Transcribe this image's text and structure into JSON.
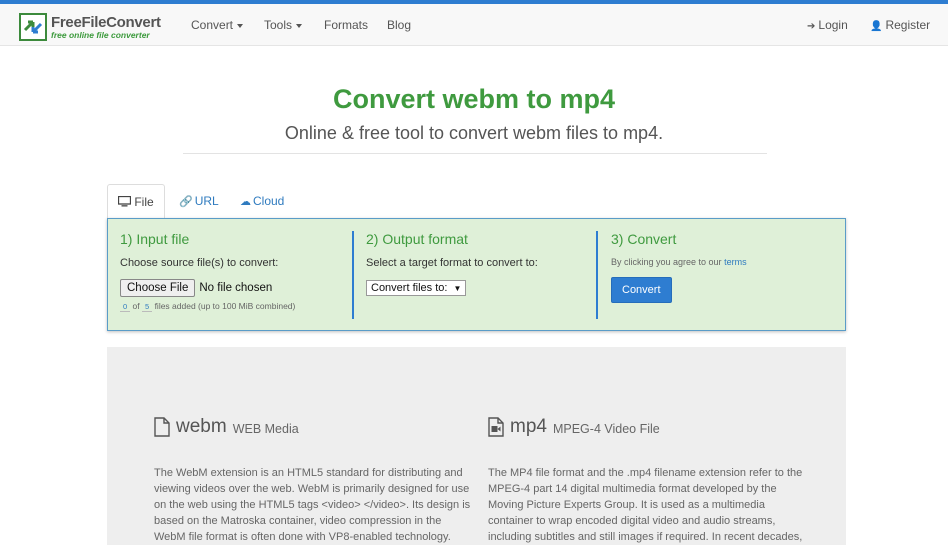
{
  "brand": {
    "title": "FreeFileConvert",
    "tagline": "free online file converter"
  },
  "nav": {
    "convert": "Convert",
    "tools": "Tools",
    "formats": "Formats",
    "blog": "Blog",
    "login": "Login",
    "register": "Register"
  },
  "hero": {
    "title": "Convert webm to mp4",
    "subtitle": "Online & free tool to convert webm files to mp4."
  },
  "tabs": {
    "file": "File",
    "url": "URL",
    "cloud": "Cloud"
  },
  "steps": {
    "input": {
      "heading": "1) Input file",
      "instruction": "Choose source file(s) to convert:",
      "choose_label": "Choose File",
      "chosen_text": "No file chosen",
      "added_count": "0",
      "of_text": "of",
      "max_count": "5",
      "limit_text": "files added (up to 100 MiB combined)"
    },
    "output": {
      "heading": "2) Output format",
      "instruction": "Select a target format to convert to:",
      "select_label": "Convert files to:"
    },
    "convert": {
      "heading": "3) Convert",
      "terms_prefix": "By clicking you agree to our",
      "terms_link": "terms",
      "button": "Convert"
    }
  },
  "formats": {
    "source": {
      "name": "webm",
      "full": "WEB Media",
      "description": "The WebM extension is an HTML5 standard for distributing and viewing videos over the web. WebM is primarily designed for use on the web using the HTML5 tags <video> </video>. Its design is based on the Matroska container, video compression in the WebM file format is often done with VP8-enabled technology. WebM is a high quality, open source, standard"
    },
    "target": {
      "name": "mp4",
      "full": "MPEG-4 Video File",
      "description": "The MP4 file format and the .mp4 filename extension refer to the MPEG-4 part 14 digital multimedia format developed by the Moving Picture Experts Group. It is used as a multimedia container to wrap encoded digital video and audio streams, including subtitles and still images if required. In recent decades, the format has been popularized as one of the main"
    }
  },
  "colors": {
    "accent_green": "#3f9a3f",
    "brand_blue": "#2e7dd1",
    "panel_bg": "#dff0d8"
  }
}
